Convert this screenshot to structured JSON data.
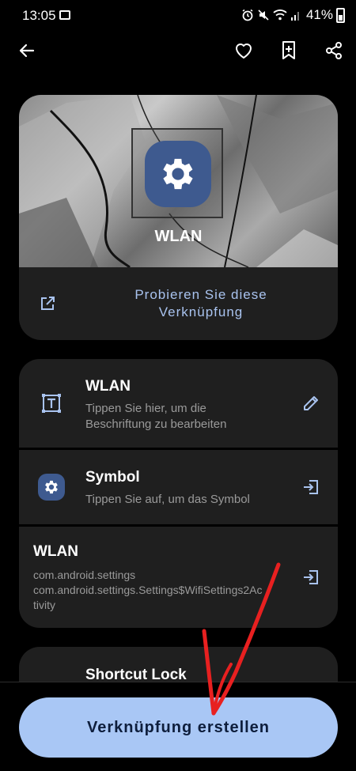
{
  "status_bar": {
    "time": "13:05",
    "battery": "41%"
  },
  "hero": {
    "title": "WLAN",
    "try_shortcut": "Probieren Sie diese Verknüpfung"
  },
  "rows": [
    {
      "title": "WLAN",
      "subtitle": "Tippen Sie hier, um die Beschriftung zu bearbeiten"
    },
    {
      "title": "Symbol",
      "subtitle": "Tippen Sie auf, um das Symbol"
    },
    {
      "title": "WLAN",
      "line1": "com.android.settings",
      "line2": "com.android.settings.Settings$WifiSettings2Ac",
      "line3": "tivity"
    }
  ],
  "lock": {
    "title": "Shortcut Lock"
  },
  "create_button": "Verknüpfung erstellen",
  "colors": {
    "accent": "#a9c7f5",
    "accent_text": "#a9c3ef",
    "icon_bg": "#3e5a8f",
    "card_bg": "#1f1f1f",
    "annotation_arrow": "#e82020"
  }
}
